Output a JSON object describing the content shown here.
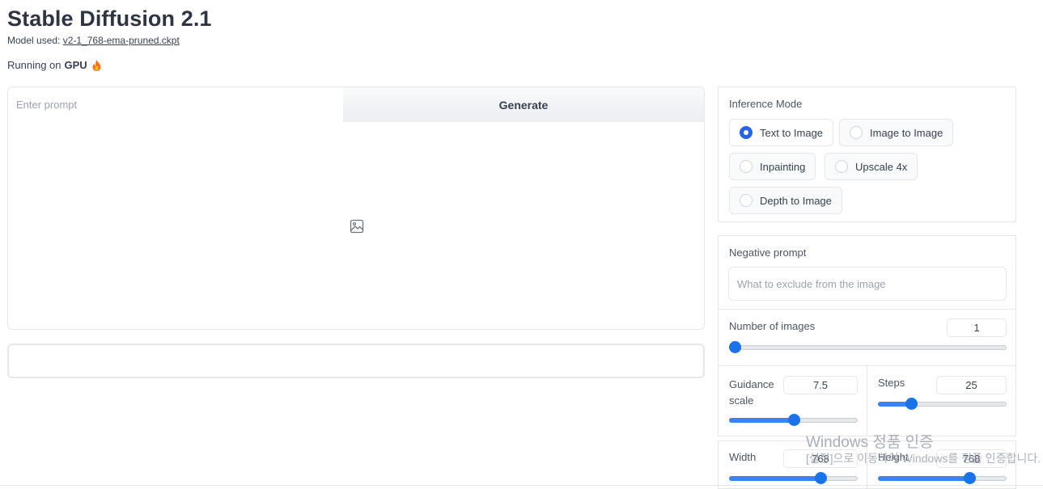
{
  "header": {
    "title": "Stable Diffusion 2.1",
    "model_prefix": "Model used: ",
    "model_link": "v2-1_768-ema-pruned.ckpt",
    "running_prefix": "Running on",
    "running_device": "GPU"
  },
  "prompt": {
    "placeholder": "Enter prompt",
    "value": "",
    "generate_label": "Generate"
  },
  "inference_mode": {
    "label": "Inference Mode",
    "options": [
      {
        "label": "Text to Image",
        "selected": true
      },
      {
        "label": "Image to Image",
        "selected": false
      },
      {
        "label": "Inpainting",
        "selected": false
      },
      {
        "label": "Upscale 4x",
        "selected": false
      },
      {
        "label": "Depth to Image",
        "selected": false
      }
    ]
  },
  "negative_prompt": {
    "label": "Negative prompt",
    "placeholder": "What to exclude from the image"
  },
  "num_images": {
    "label": "Number of images",
    "value": "1",
    "min": 1,
    "max": 4
  },
  "guidance_scale": {
    "label": "Guidance scale",
    "value": "7.5",
    "min": 0,
    "max": 15
  },
  "steps": {
    "label": "Steps",
    "value": "25",
    "min": 2,
    "max": 100
  },
  "width": {
    "label": "Width",
    "value": "768",
    "min": 64,
    "max": 1024
  },
  "height": {
    "label": "Height",
    "value": "768",
    "min": 64,
    "max": 1024
  },
  "watermark": {
    "title": "Windows 정품 인증",
    "subtitle": "[설정]으로 이동하여 Windows를 정품 인증합니다."
  },
  "colors": {
    "accent": "#2563eb",
    "slider": "#1a73e8",
    "border": "#e5e7eb"
  },
  "icons": {
    "image_placeholder": "image-icon",
    "flame": "fire-icon"
  }
}
